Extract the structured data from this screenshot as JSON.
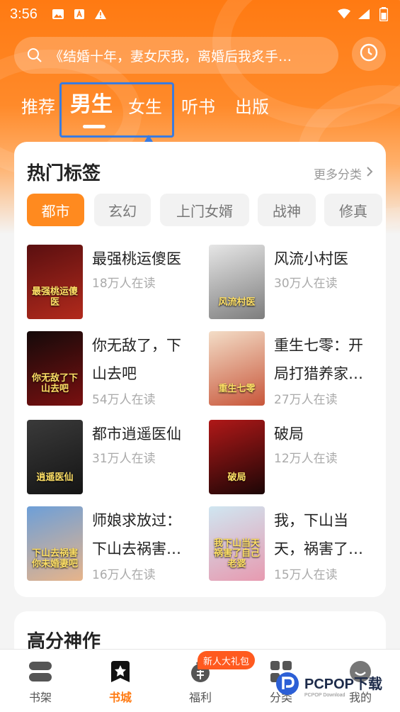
{
  "status_bar": {
    "time": "3:56"
  },
  "search": {
    "placeholder": "《结婚十年，妻女厌我，离婚后我炙手…"
  },
  "tabs": [
    {
      "label": "推荐"
    },
    {
      "label": "男生"
    },
    {
      "label": "女生"
    },
    {
      "label": "听书"
    },
    {
      "label": "出版"
    }
  ],
  "hot_tags": {
    "title": "热门标签",
    "more": "更多分类",
    "chips": [
      "都市",
      "玄幻",
      "上门女婿",
      "战神",
      "修真"
    ],
    "books": [
      {
        "title": "最强桃运傻医",
        "readers": "18万人在读",
        "cover_text": "最强桃运傻医",
        "cover_colors": [
          "#5a0f10",
          "#b22a1c"
        ]
      },
      {
        "title": "风流小村医",
        "readers": "30万人在读",
        "cover_text": "风流村医",
        "cover_colors": [
          "#e6e6e6",
          "#7d7d7d"
        ]
      },
      {
        "title": "你无敌了，下山去吧",
        "readers": "54万人在读",
        "cover_text": "你无敌了下山去吧",
        "cover_colors": [
          "#140a0a",
          "#7a1010"
        ]
      },
      {
        "title": "重生七零：开局打猎养家…",
        "readers": "27万人在读",
        "cover_text": "重生七零",
        "cover_colors": [
          "#f3ddc7",
          "#c8563a"
        ]
      },
      {
        "title": "都市逍遥医仙",
        "readers": "31万人在读",
        "cover_text": "逍遥医仙",
        "cover_colors": [
          "#3a3a3a",
          "#141414"
        ]
      },
      {
        "title": "破局",
        "readers": "12万人在读",
        "cover_text": "破局",
        "cover_colors": [
          "#b01818",
          "#1c0606"
        ]
      },
      {
        "title": "师娘求放过：下山去祸害…",
        "readers": "16万人在读",
        "cover_text": "下山去祸害你未婚妻吧",
        "cover_colors": [
          "#6d9fd8",
          "#e7b48a"
        ]
      },
      {
        "title": "我，下山当天，祸害了…",
        "readers": "15万人在读",
        "cover_text": "我下山当天祸害了自己老婆",
        "cover_colors": [
          "#cfe6f1",
          "#e79ab0"
        ]
      }
    ]
  },
  "second_section": {
    "title": "高分神作"
  },
  "bottom_nav": {
    "items": [
      {
        "label": "书架",
        "icon": "bookshelf-icon"
      },
      {
        "label": "书城",
        "icon": "bookstore-icon"
      },
      {
        "label": "福利",
        "icon": "welfare-icon"
      },
      {
        "label": "分类",
        "icon": "category-icon"
      },
      {
        "label": "我的",
        "icon": "profile-icon"
      }
    ],
    "badge": "新人大礼包"
  },
  "watermark": {
    "brand": "PCPOP下载",
    "sub": "PCPOP Download"
  },
  "colors": {
    "accent": "#ff7a12",
    "annotation": "#3a7be0"
  }
}
